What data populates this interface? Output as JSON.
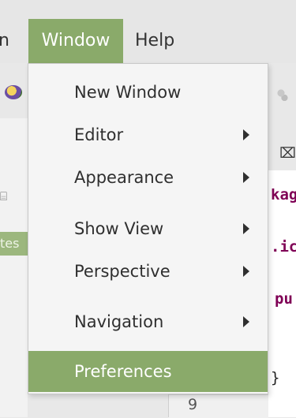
{
  "menubar": {
    "partial_label": "n",
    "window_label": "Window",
    "help_label": "Help"
  },
  "left_panel": {
    "tab_glyph": "⌸",
    "selected_text": "tes"
  },
  "editor": {
    "close_glyph": "⌧",
    "code_lines": [
      "kag",
      ".ic",
      "pu",
      "}"
    ],
    "line_number": "9"
  },
  "window_menu": {
    "items": [
      {
        "label": "New Window",
        "has_submenu": false
      },
      {
        "label": "Editor",
        "has_submenu": true
      },
      {
        "label": "Appearance",
        "has_submenu": true
      },
      {
        "label": "Show View",
        "has_submenu": true
      },
      {
        "label": "Perspective",
        "has_submenu": true
      },
      {
        "label": "Navigation",
        "has_submenu": true
      },
      {
        "label": "Preferences",
        "has_submenu": false,
        "highlighted": true
      }
    ]
  },
  "colors": {
    "accent": "#8aaa6a",
    "menu_bg": "#f5f5f5",
    "keyword": "#7f0055"
  }
}
